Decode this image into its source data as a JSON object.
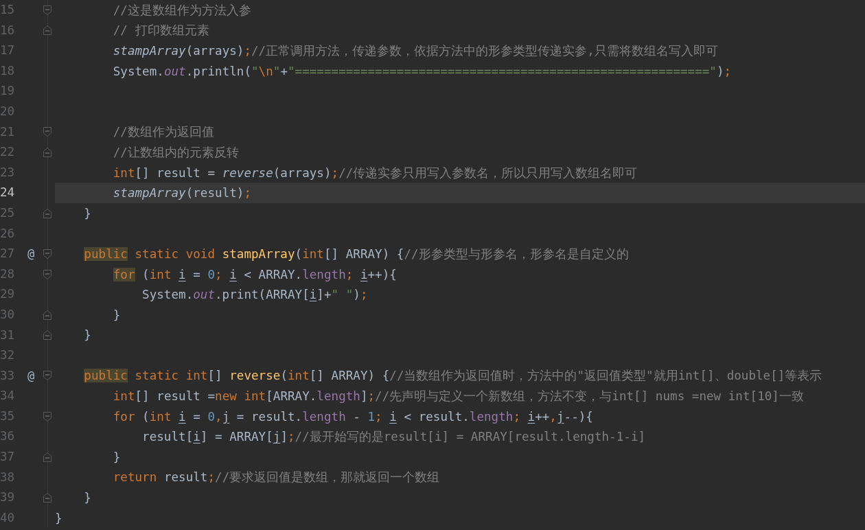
{
  "editor": {
    "lines": [
      {
        "children": [
          {
            "children": [
              {
                "number": "15",
                "fold_open": true,
                "fold_close": false,
                "current": false,
                "tokens": [
                  {
                    "kind": "comment",
                    "text": "//这是数组作为方法入参"
                  }
                ]
              },
              {
                "number": "16",
                "fold_open": false,
                "fold_close": true,
                "current": false,
                "tokens": [
                  {
                    "kind": "comment",
                    "text": "// 打印数组元素"
                  }
                ]
              },
              {
                "number": "17",
                "fold_open": false,
                "fold_close": false,
                "current": false,
                "tokens": [
                  {
                    "kind": "static-call",
                    "text": "stampArray"
                  },
                  {
                    "kind": "plain",
                    "text": "(arrays)"
                  },
                  {
                    "kind": "semicolon",
                    "text": ";"
                  },
                  {
                    "kind": "comment",
                    "text": "//正常调用方法，传递参数，依据方法中的形参类型传递实参,只需将数组名写入即可"
                  }
                ]
              },
              {
                "number": "18",
                "fold_open": false,
                "fold_close": false,
                "current": false,
                "tokens": [
                  {
                    "kind": "plain",
                    "text": "System."
                  },
                  {
                    "kind": "field",
                    "text": "out"
                  },
                  {
                    "kind": "plain",
                    "text": ".println("
                  },
                  {
                    "kind": "string",
                    "text": "\""
                  },
                  {
                    "kind": "escape",
                    "text": "\\n"
                  },
                  {
                    "kind": "string",
                    "text": "\""
                  },
                  {
                    "kind": "plain",
                    "text": "+"
                  },
                  {
                    "kind": "string",
                    "text": "\"=========================================================\""
                  },
                  {
                    "kind": "plain",
                    "text": ")"
                  },
                  {
                    "kind": "semicolon",
                    "text": ";"
                  }
                ]
              },
              {
                "number": "19",
                "fold_open": false,
                "fold_close": false,
                "current": false
              },
              {
                "number": "20",
                "fold_open": false,
                "fold_close": false,
                "current": false
              },
              {
                "number": "21",
                "fold_open": true,
                "fold_close": false,
                "current": false,
                "tokens": [
                  {
                    "kind": "comment",
                    "text": "//数组作为返回值"
                  }
                ]
              },
              {
                "number": "22",
                "fold_open": false,
                "fold_close": true,
                "current": false,
                "tokens": [
                  {
                    "kind": "comment",
                    "text": "//让数组内的元素反转"
                  }
                ]
              },
              {
                "number": "23",
                "fold_open": false,
                "fold_close": false,
                "current": false,
                "tokens": [
                  {
                    "kind": "keyword",
                    "text": "int"
                  },
                  {
                    "kind": "plain",
                    "text": "[] result = "
                  },
                  {
                    "kind": "static-call",
                    "text": "reverse"
                  },
                  {
                    "kind": "plain",
                    "text": "(arrays)"
                  },
                  {
                    "kind": "semicolon",
                    "text": ";"
                  },
                  {
                    "kind": "comment",
                    "text": "//传递实参只用写入参数名，所以只用写入数组名即可"
                  }
                ]
              },
              {
                "number": "24",
                "fold_open": false,
                "fold_close": false,
                "current": true,
                "tokens": [
                  {
                    "kind": "static-call",
                    "text": "stampArray"
                  },
                  {
                    "kind": "plain",
                    "text": "(result)"
                  },
                  {
                    "kind": "semicolon",
                    "text": ";"
                  }
                ]
              }
            ]
          },
          {
            "number": "25",
            "fold_open": false,
            "fold_close": true,
            "current": false,
            "tokens": [
              {
                "kind": "plain",
                "text": "}"
              }
            ]
          },
          {
            "number": "26",
            "fold_open": false,
            "fold_close": false,
            "current": false
          },
          {
            "number": "27",
            "fold_open": true,
            "fold_close": false,
            "current": false,
            "marker": "@",
            "tokens": [
              {
                "kind": "keyword-marked",
                "text": "public"
              },
              {
                "kind": "keyword",
                "text": " static void "
              },
              {
                "kind": "method",
                "text": "stampArray"
              },
              {
                "kind": "plain",
                "text": "("
              },
              {
                "kind": "keyword",
                "text": "int"
              },
              {
                "kind": "plain",
                "text": "[] ARRAY) {"
              },
              {
                "kind": "comment",
                "text": "//形参类型与形参名，形参名是自定义的"
              }
            ],
            "children": [
              {
                "number": "28",
                "fold_open": true,
                "fold_close": false,
                "current": false,
                "tokens": [
                  {
                    "kind": "keyword-marked",
                    "text": "for"
                  },
                  {
                    "kind": "plain",
                    "text": " ("
                  },
                  {
                    "kind": "keyword",
                    "text": "int "
                  },
                  {
                    "kind": "var",
                    "text": "i"
                  },
                  {
                    "kind": "plain",
                    "text": " = "
                  },
                  {
                    "kind": "number",
                    "text": "0"
                  },
                  {
                    "kind": "semicolon",
                    "text": "; "
                  },
                  {
                    "kind": "var",
                    "text": "i"
                  },
                  {
                    "kind": "plain",
                    "text": " < ARRAY."
                  },
                  {
                    "kind": "field-plain",
                    "text": "length"
                  },
                  {
                    "kind": "semicolon",
                    "text": "; "
                  },
                  {
                    "kind": "var",
                    "text": "i"
                  },
                  {
                    "kind": "plain",
                    "text": "++){"
                  }
                ],
                "children": [
                  {
                    "number": "29",
                    "fold_open": false,
                    "fold_close": false,
                    "current": false,
                    "tokens": [
                      {
                        "kind": "plain",
                        "text": "System."
                      },
                      {
                        "kind": "field",
                        "text": "out"
                      },
                      {
                        "kind": "plain",
                        "text": ".print(ARRAY["
                      },
                      {
                        "kind": "var",
                        "text": "i"
                      },
                      {
                        "kind": "plain",
                        "text": "]+"
                      },
                      {
                        "kind": "string",
                        "text": "\" \""
                      },
                      {
                        "kind": "plain",
                        "text": ")"
                      },
                      {
                        "kind": "semicolon",
                        "text": ";"
                      }
                    ]
                  }
                ]
              },
              {
                "number": "30",
                "fold_open": false,
                "fold_close": true,
                "current": false,
                "tokens": [
                  {
                    "kind": "plain",
                    "text": "}"
                  }
                ]
              }
            ]
          },
          {
            "number": "31",
            "fold_open": false,
            "fold_close": true,
            "current": false,
            "tokens": [
              {
                "kind": "plain",
                "text": "}"
              }
            ]
          },
          {
            "number": "32",
            "fold_open": false,
            "fold_close": false,
            "current": false
          },
          {
            "number": "33",
            "fold_open": true,
            "fold_close": false,
            "current": false,
            "marker": "@",
            "tokens": [
              {
                "kind": "keyword-marked",
                "text": "public"
              },
              {
                "kind": "keyword",
                "text": " static int"
              },
              {
                "kind": "plain",
                "text": "[] "
              },
              {
                "kind": "method",
                "text": "reverse"
              },
              {
                "kind": "plain",
                "text": "("
              },
              {
                "kind": "keyword",
                "text": "int"
              },
              {
                "kind": "plain",
                "text": "[] ARRAY) {"
              },
              {
                "kind": "comment",
                "text": "//当数组作为返回值时，方法中的\"返回值类型\"就用int[]、double[]等表示"
              }
            ],
            "children": [
              {
                "number": "34",
                "fold_open": false,
                "fold_close": false,
                "current": false,
                "tokens": [
                  {
                    "kind": "keyword",
                    "text": "int"
                  },
                  {
                    "kind": "plain",
                    "text": "[] result ="
                  },
                  {
                    "kind": "keyword",
                    "text": "new int"
                  },
                  {
                    "kind": "plain",
                    "text": "[ARRAY."
                  },
                  {
                    "kind": "field-plain",
                    "text": "length"
                  },
                  {
                    "kind": "plain",
                    "text": "]"
                  },
                  {
                    "kind": "semicolon",
                    "text": ";"
                  },
                  {
                    "kind": "comment",
                    "text": "//先声明与定义一个新数组，方法不变，与int[] nums =new int[10]一致"
                  }
                ]
              },
              {
                "number": "35",
                "fold_open": true,
                "fold_close": false,
                "current": false,
                "tokens": [
                  {
                    "kind": "keyword",
                    "text": "for"
                  },
                  {
                    "kind": "plain",
                    "text": " ("
                  },
                  {
                    "kind": "keyword",
                    "text": "int "
                  },
                  {
                    "kind": "var",
                    "text": "i"
                  },
                  {
                    "kind": "plain",
                    "text": " = "
                  },
                  {
                    "kind": "number",
                    "text": "0"
                  },
                  {
                    "kind": "semicolon",
                    "text": ","
                  },
                  {
                    "kind": "var",
                    "text": "j"
                  },
                  {
                    "kind": "plain",
                    "text": " = result."
                  },
                  {
                    "kind": "field-plain",
                    "text": "length"
                  },
                  {
                    "kind": "plain",
                    "text": " - "
                  },
                  {
                    "kind": "number",
                    "text": "1"
                  },
                  {
                    "kind": "semicolon",
                    "text": "; "
                  },
                  {
                    "kind": "var",
                    "text": "i"
                  },
                  {
                    "kind": "plain",
                    "text": " < result."
                  },
                  {
                    "kind": "field-plain",
                    "text": "length"
                  },
                  {
                    "kind": "semicolon",
                    "text": "; "
                  },
                  {
                    "kind": "var",
                    "text": "i"
                  },
                  {
                    "kind": "plain",
                    "text": "++"
                  },
                  {
                    "kind": "semicolon",
                    "text": ","
                  },
                  {
                    "kind": "var",
                    "text": "j"
                  },
                  {
                    "kind": "plain",
                    "text": "--){"
                  }
                ],
                "children": [
                  {
                    "number": "36",
                    "fold_open": false,
                    "fold_close": false,
                    "current": false,
                    "tokens": [
                      {
                        "kind": "plain",
                        "text": "result["
                      },
                      {
                        "kind": "var",
                        "text": "i"
                      },
                      {
                        "kind": "plain",
                        "text": "] = ARRAY["
                      },
                      {
                        "kind": "var",
                        "text": "j"
                      },
                      {
                        "kind": "plain",
                        "text": "]"
                      },
                      {
                        "kind": "semicolon",
                        "text": ";"
                      },
                      {
                        "kind": "comment",
                        "text": "//最开始写的是result[i] = ARRAY[result.length-1-i]"
                      }
                    ]
                  }
                ]
              },
              {
                "number": "37",
                "fold_open": false,
                "fold_close": true,
                "current": false,
                "tokens": [
                  {
                    "kind": "plain",
                    "text": "}"
                  }
                ]
              },
              {
                "number": "38",
                "fold_open": false,
                "fold_close": false,
                "current": false,
                "tokens": [
                  {
                    "kind": "keyword",
                    "text": "return"
                  },
                  {
                    "kind": "plain",
                    "text": " result"
                  },
                  {
                    "kind": "semicolon",
                    "text": ";"
                  },
                  {
                    "kind": "comment",
                    "text": "//要求返回值是数组，那就返回一个数组"
                  }
                ]
              }
            ]
          },
          {
            "number": "39",
            "fold_open": false,
            "fold_close": true,
            "current": false,
            "tokens": [
              {
                "kind": "plain",
                "text": "}"
              }
            ]
          }
        ]
      },
      {
        "number": "40",
        "fold_open": false,
        "fold_close": false,
        "current": false,
        "tokens": [
          {
            "kind": "plain",
            "text": "}"
          }
        ]
      }
    ]
  }
}
